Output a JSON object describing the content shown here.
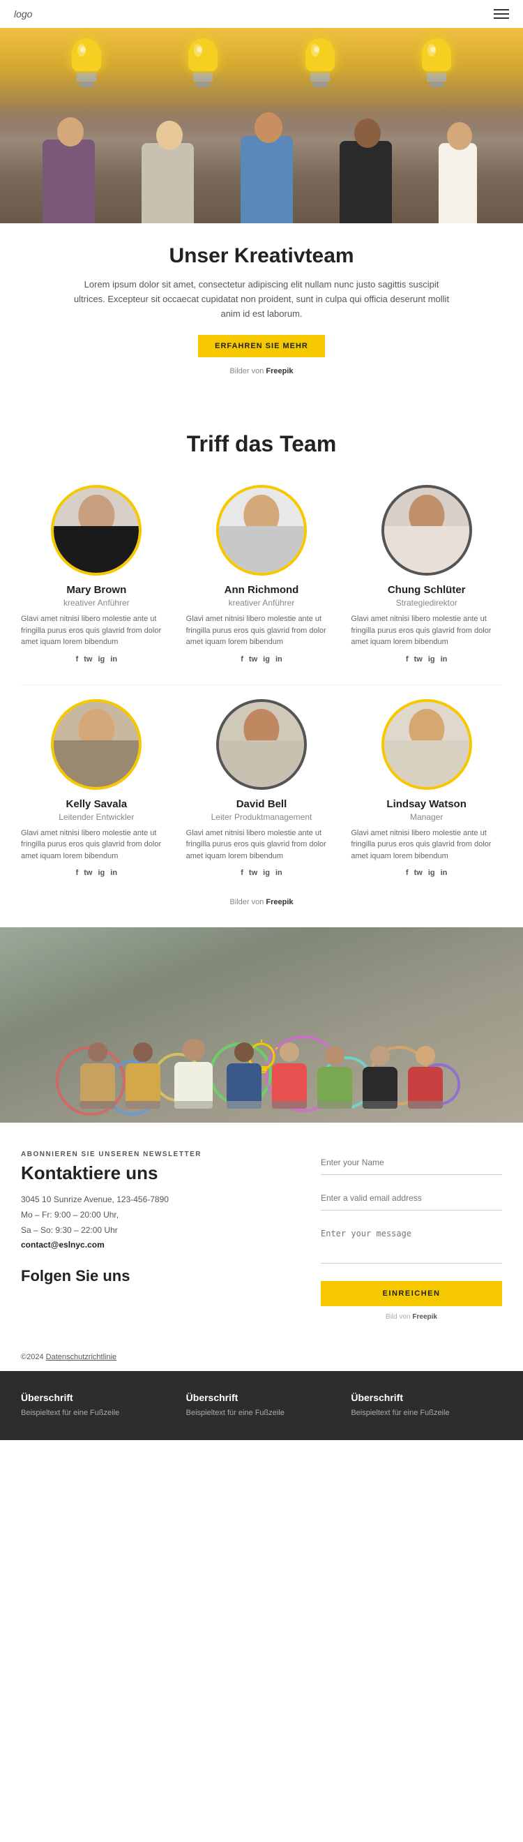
{
  "header": {
    "logo": "logo",
    "menu_icon": "≡"
  },
  "hero": {
    "title": "Unser Kreativteam",
    "description": "Lorem ipsum dolor sit amet, consectetur adipiscing elit nullam nunc justo sagittis suscipit ultrices. Excepteur sit occaecat cupidatat non proident, sunt in culpa qui officia deserunt mollit anim id est laborum.",
    "button_label": "ERFAHREN SIE MEHR",
    "freepik_text": "Bilder von",
    "freepik_link": "Freepik"
  },
  "team_section": {
    "title": "Triff das Team",
    "freepik_text": "Bilder von",
    "freepik_link": "Freepik",
    "lorem": "Glavi amet nitnisi libero molestie ante ut fringilla purus eros quis glavrid from dolor amet iquam lorem bibendum",
    "members": [
      {
        "name": "Mary Brown",
        "role": "kreativer Anführer",
        "desc": "Glavi amet nitnisi libero molestie ante ut fringilla purus eros quis glavrid from dolor amet iquam lorem bibendum",
        "socials": [
          "f",
          "tw",
          "ig",
          "in"
        ]
      },
      {
        "name": "Ann Richmond",
        "role": "kreativer Anführer",
        "desc": "Glavi amet nitnisi libero molestie ante ut fringilla purus eros quis glavrid from dolor amet iquam lorem bibendum",
        "socials": [
          "f",
          "tw",
          "ig",
          "in"
        ]
      },
      {
        "name": "Chung Schlüter",
        "role": "Strategiedirektor",
        "desc": "Glavi amet nitnisi libero molestie ante ut fringilla purus eros quis glavrid from dolor amet iquam lorem bibendum",
        "socials": [
          "f",
          "tw",
          "ig",
          "in"
        ]
      },
      {
        "name": "Kelly Savala",
        "role": "Leitender Entwickler",
        "desc": "Glavi amet nitnisi libero molestie ante ut fringilla purus eros quis glavrid from dolor amet iquam lorem bibendum",
        "socials": [
          "f",
          "tw",
          "ig",
          "in"
        ]
      },
      {
        "name": "David Bell",
        "role": "Leiter Produktmanagement",
        "desc": "Glavi amet nitnisi libero molestie ante ut fringilla purus eros quis glavrid from dolor amet iquam lorem bibendum",
        "socials": [
          "f",
          "tw",
          "ig",
          "in"
        ]
      },
      {
        "name": "Lindsay Watson",
        "role": "Manager",
        "desc": "Glavi amet nitnisi libero molestie ante ut fringilla purus eros quis glavrid from dolor amet iquam lorem bibendum",
        "socials": [
          "f",
          "tw",
          "ig",
          "in"
        ]
      }
    ]
  },
  "contact": {
    "newsletter_label": "ABONNIEREN SIE UNSEREN NEWSLETTER",
    "title": "Kontaktiere uns",
    "address": "3045 10 Sunrize Avenue, 123-456-7890",
    "hours1": "Mo – Fr: 9:00 – 20:00 Uhr,",
    "hours2": "Sa – So: 9:30 – 22:00 Uhr",
    "email": "contact@eslnyc.com",
    "follow_title": "Folgen Sie uns",
    "form": {
      "name_placeholder": "Enter your Name",
      "email_placeholder": "Enter a valid email address",
      "message_placeholder": "Enter your message",
      "submit_label": "EINREICHEN"
    },
    "freepik_text": "Bild von",
    "freepik_link": "Freepik"
  },
  "copyright": {
    "text": "©2024",
    "link": "Datenschutzrichtlinie"
  },
  "footer": {
    "columns": [
      {
        "title": "Überschrift",
        "subtitle": "Beispieltext für eine Fußzeile"
      },
      {
        "title": "Überschrift",
        "subtitle": "Beispieltext für eine Fußzeile"
      },
      {
        "title": "Überschrift",
        "subtitle": "Beispieltext für eine Fußzeile"
      }
    ]
  }
}
